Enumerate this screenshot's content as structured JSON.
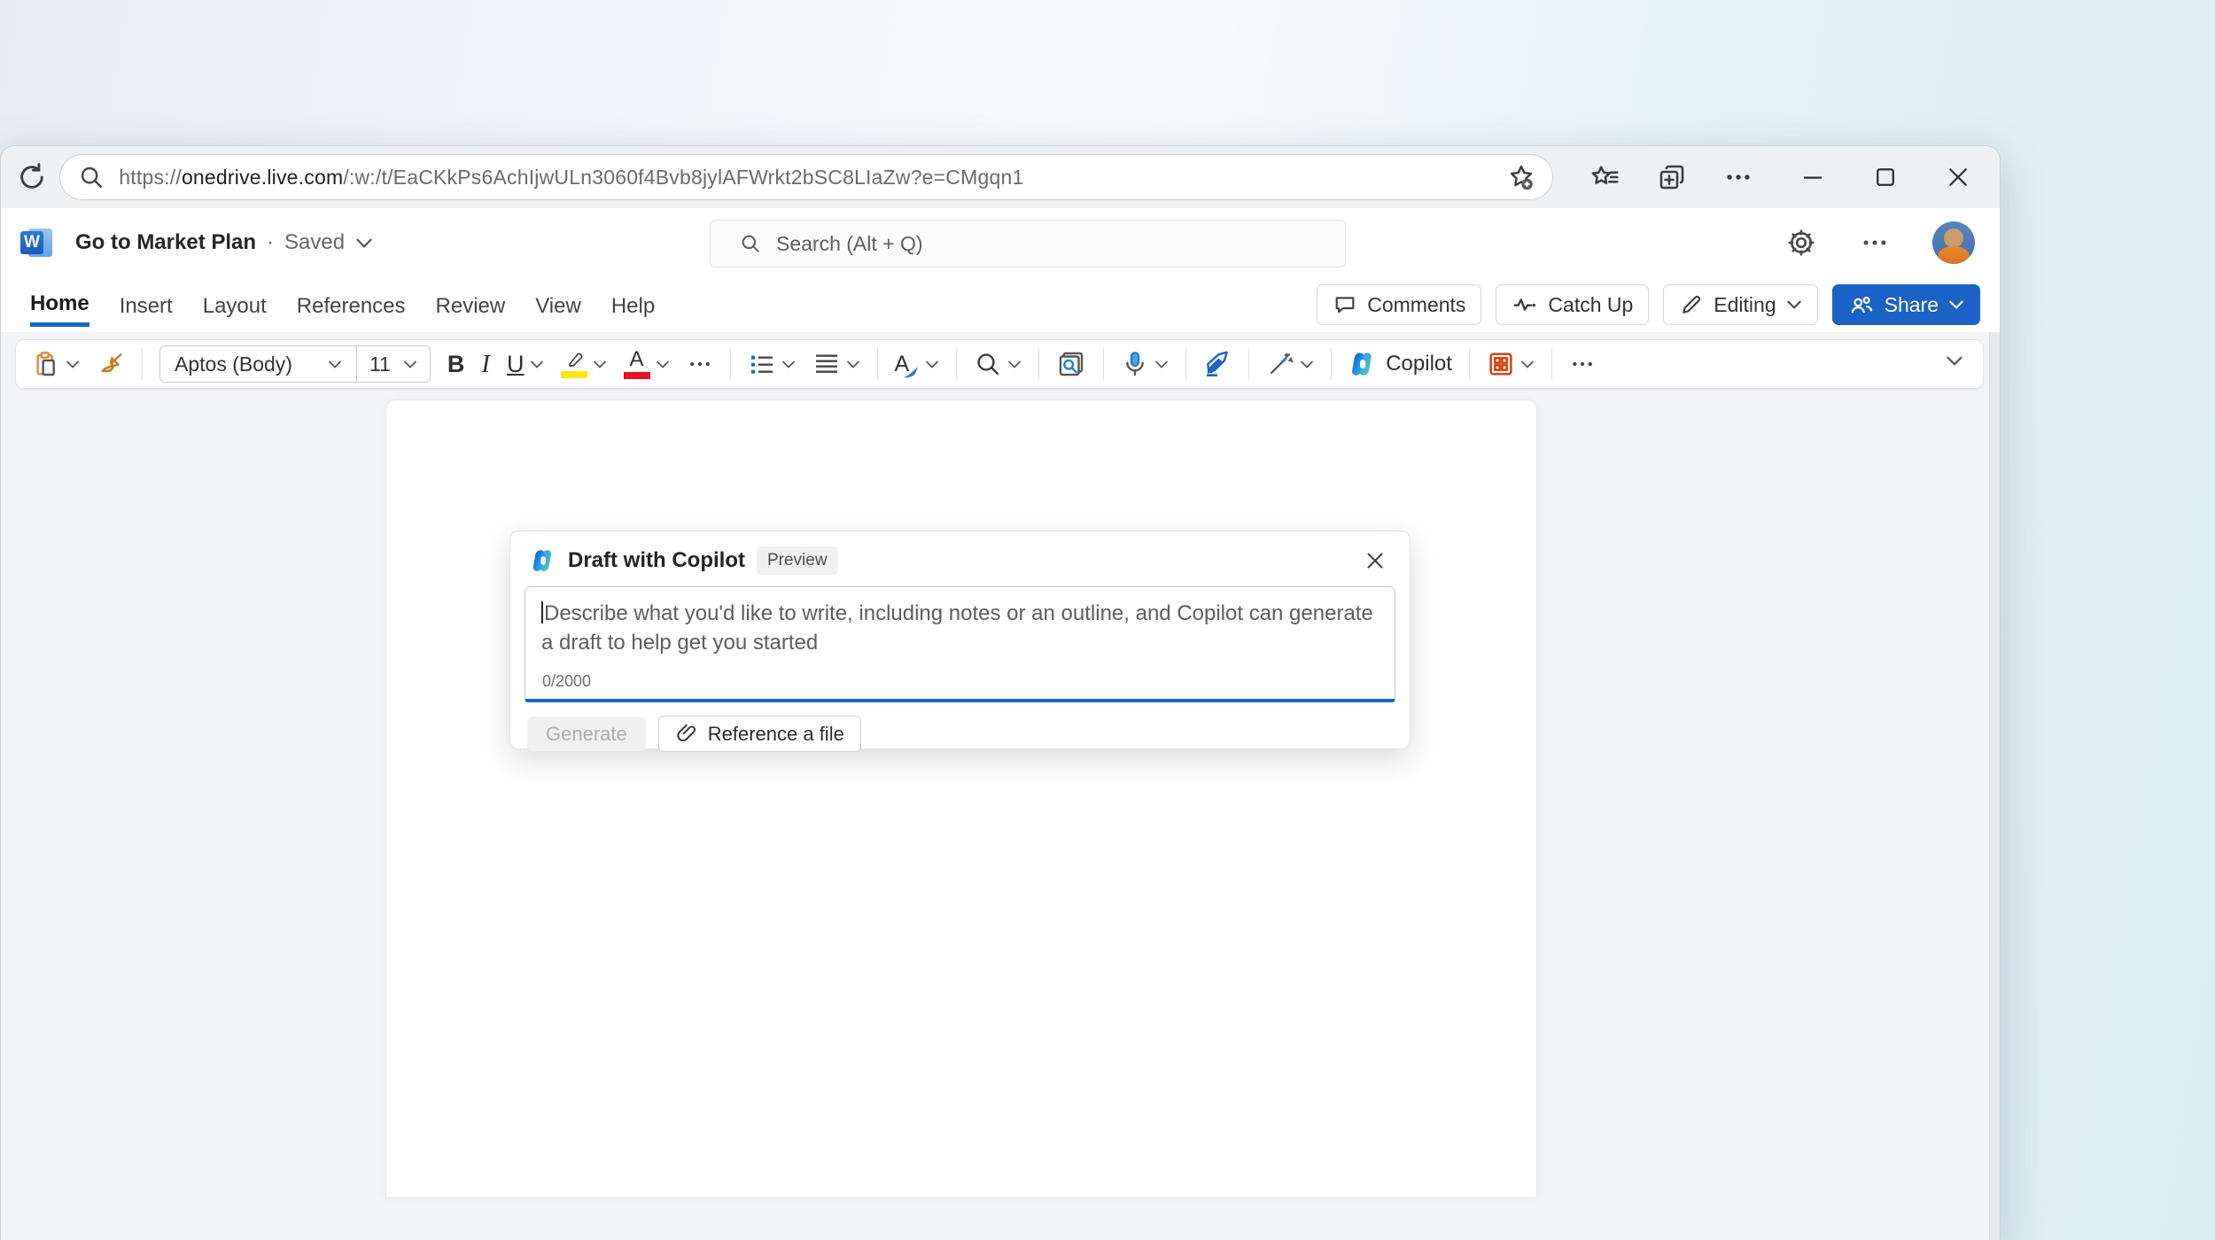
{
  "browser": {
    "url": {
      "prefix": "https://",
      "domain": "onedrive.live.com",
      "path": "/:w:/t/EaCKkPs6AchIjwULn3060f4Bvb8jylAFWrkt2bSC8LIaZw?e=CMgqn1"
    }
  },
  "app_header": {
    "logo_letter": "W",
    "doc_title": "Go to Market Plan",
    "separator": "·",
    "save_status": "Saved",
    "search_placeholder": "Search (Alt + Q)"
  },
  "ribbon": {
    "tabs": [
      {
        "label": "Home",
        "active": true
      },
      {
        "label": "Insert",
        "active": false
      },
      {
        "label": "Layout",
        "active": false
      },
      {
        "label": "References",
        "active": false
      },
      {
        "label": "Review",
        "active": false
      },
      {
        "label": "View",
        "active": false
      },
      {
        "label": "Help",
        "active": false
      }
    ],
    "actions": {
      "comments": "Comments",
      "catch_up": "Catch Up",
      "editing": "Editing",
      "share": "Share"
    }
  },
  "format_toolbar": {
    "font_name": "Aptos (Body)",
    "font_size": "11",
    "bold": "B",
    "italic": "I",
    "underline": "U",
    "font_color_letter": "A",
    "styles_letter": "A",
    "copilot_label": "Copilot"
  },
  "copilot_dialog": {
    "title": "Draft with Copilot",
    "badge": "Preview",
    "placeholder": "Describe what you'd like to write, including notes or an outline, and Copilot can generate a draft to help get you started",
    "char_counter": "0/2000",
    "generate_label": "Generate",
    "reference_label": "Reference a file"
  },
  "colors": {
    "accent_blue": "#1a66c6",
    "share_button": "#1a62c6",
    "word_logo": "#185abd",
    "apps_grid_orange": "#d83b01",
    "highlight_yellow": "#ffe812",
    "font_color_red": "#e81123",
    "page_background": "#f3f4f6",
    "desktop_teal": "#d9edf3"
  }
}
